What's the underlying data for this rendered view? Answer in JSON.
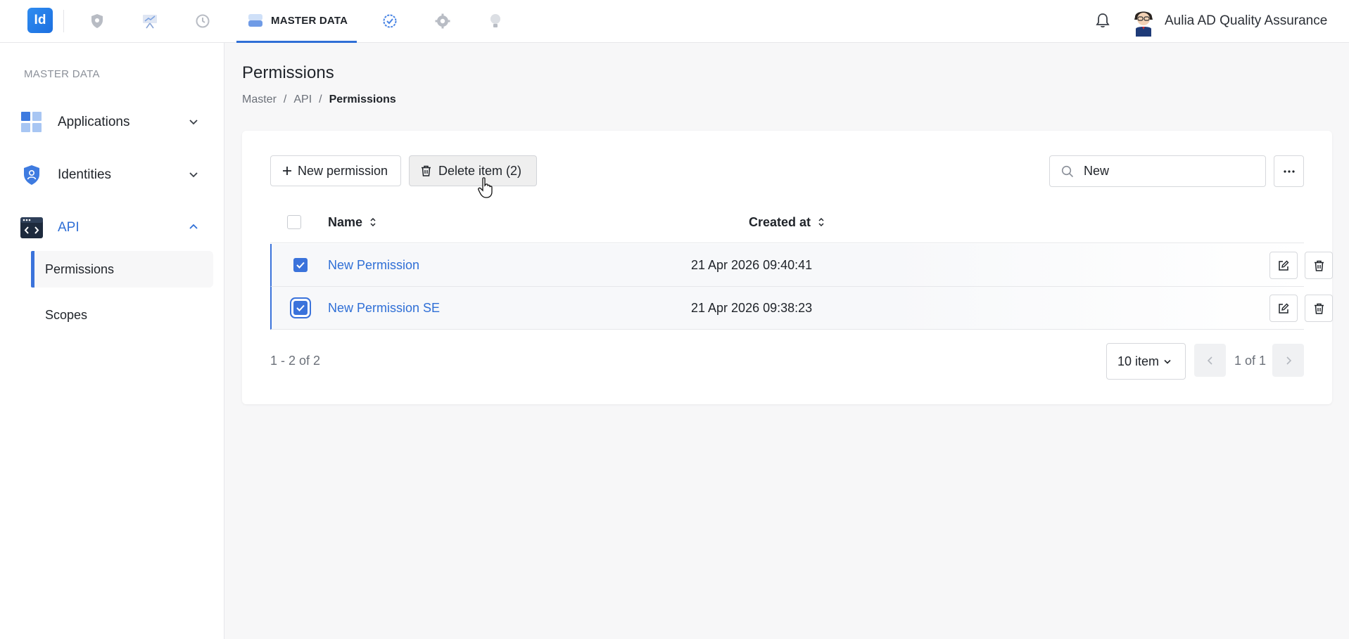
{
  "header": {
    "logo_text": "Id",
    "active_tab_label": "MASTER DATA",
    "nav_icons": [
      "shield-icon",
      "presentation-icon",
      "history-icon",
      "database-icon",
      "badge-check-icon",
      "settings-icon",
      "bulb-icon"
    ],
    "user_name": "Aulia AD Quality Assurance"
  },
  "sidebar": {
    "section_title": "MASTER DATA",
    "items": [
      {
        "label": "Applications",
        "icon": "applications-icon",
        "expanded": false
      },
      {
        "label": "Identities",
        "icon": "identity-shield-icon",
        "expanded": false
      },
      {
        "label": "API",
        "icon": "api-code-icon",
        "expanded": true
      }
    ],
    "sub_items": [
      {
        "label": "Permissions",
        "active": true
      },
      {
        "label": "Scopes",
        "active": false
      }
    ]
  },
  "page": {
    "title": "Permissions",
    "breadcrumb": [
      "Master",
      "API",
      "Permissions"
    ]
  },
  "toolbar": {
    "new_label": "New permission",
    "delete_label": "Delete item (2)",
    "search_value": "New"
  },
  "table": {
    "columns": [
      "Name",
      "Created at"
    ],
    "rows": [
      {
        "name": "New Permission",
        "created_at": "21 Apr 2026 09:40:41",
        "selected": true
      },
      {
        "name": "New Permission SE",
        "created_at": "21 Apr 2026 09:38:23",
        "selected": true
      }
    ]
  },
  "pagination": {
    "range": "1 - 2 of 2",
    "page_size": "10 item",
    "page_label": "1 of 1"
  },
  "colors": {
    "accent": "#3b73db",
    "link": "#2f6fd6"
  }
}
